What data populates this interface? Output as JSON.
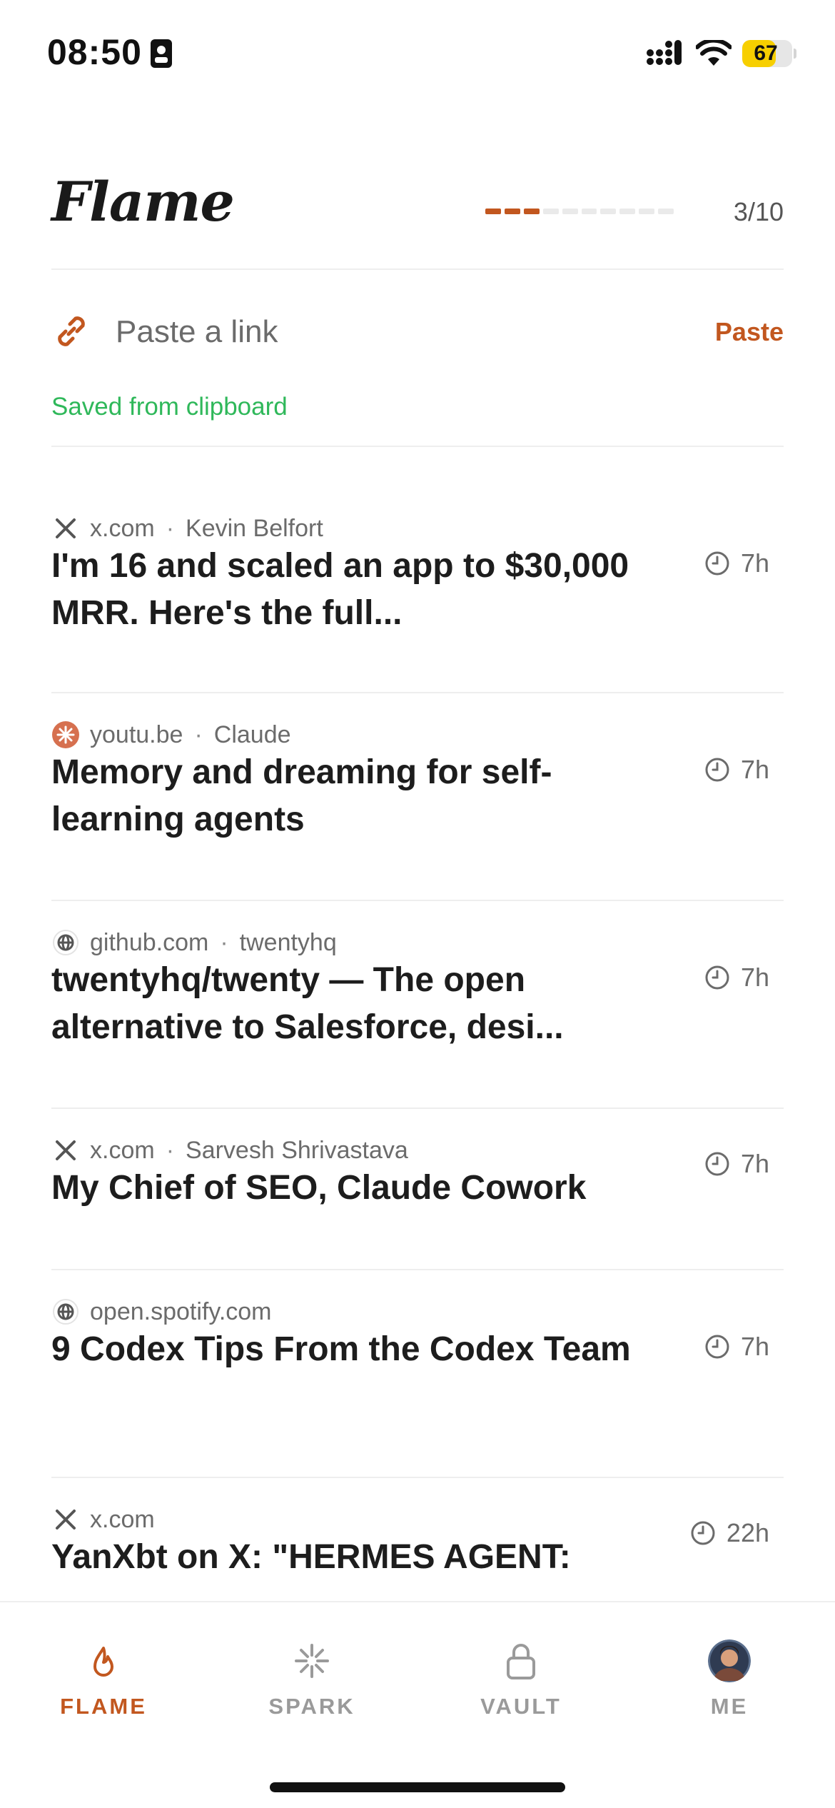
{
  "status_bar": {
    "time": "08:50",
    "battery": "67",
    "battery_level": 0.67
  },
  "header": {
    "title": "Flame",
    "progress_count": "3/10",
    "progress_filled": 3,
    "progress_total": 10,
    "accent_color": "#c2571f"
  },
  "paste": {
    "placeholder": "Paste a link",
    "button": "Paste",
    "status": "Saved from clipboard",
    "status_color": "#2fb85a"
  },
  "feed": [
    {
      "icon": "x-logo-icon",
      "domain": "x.com",
      "author": "Kevin Belfort",
      "title": "I'm 16 and scaled an app to $30,000 MRR. Here's the full...",
      "age": "7h"
    },
    {
      "icon": "claude-logo-icon",
      "domain": "youtu.be",
      "author": "Claude",
      "title": "Memory and dreaming for self-learning agents",
      "age": "7h"
    },
    {
      "icon": "globe-icon",
      "domain": "github.com",
      "author": "twentyhq",
      "title": "twentyhq/twenty — The open alternative to Salesforce, desi...",
      "age": "7h"
    },
    {
      "icon": "x-logo-icon",
      "domain": "x.com",
      "author": "Sarvesh Shrivastava",
      "title": "My Chief of SEO, Claude Cowork",
      "age": "7h"
    },
    {
      "icon": "globe-icon",
      "domain": "open.spotify.com",
      "author": "",
      "title": "9 Codex Tips From the Codex Team",
      "age": "7h"
    },
    {
      "icon": "x-logo-icon",
      "domain": "x.com",
      "author": "",
      "title": "YanXbt on X: \"HERMES AGENT:",
      "age": "22h"
    }
  ],
  "tabs": [
    {
      "label": "FLAME",
      "icon": "flame-icon",
      "active": true
    },
    {
      "label": "SPARK",
      "icon": "spark-icon",
      "active": false
    },
    {
      "label": "VAULT",
      "icon": "lock-icon",
      "active": false
    },
    {
      "label": "ME",
      "icon": "avatar",
      "active": false
    }
  ]
}
